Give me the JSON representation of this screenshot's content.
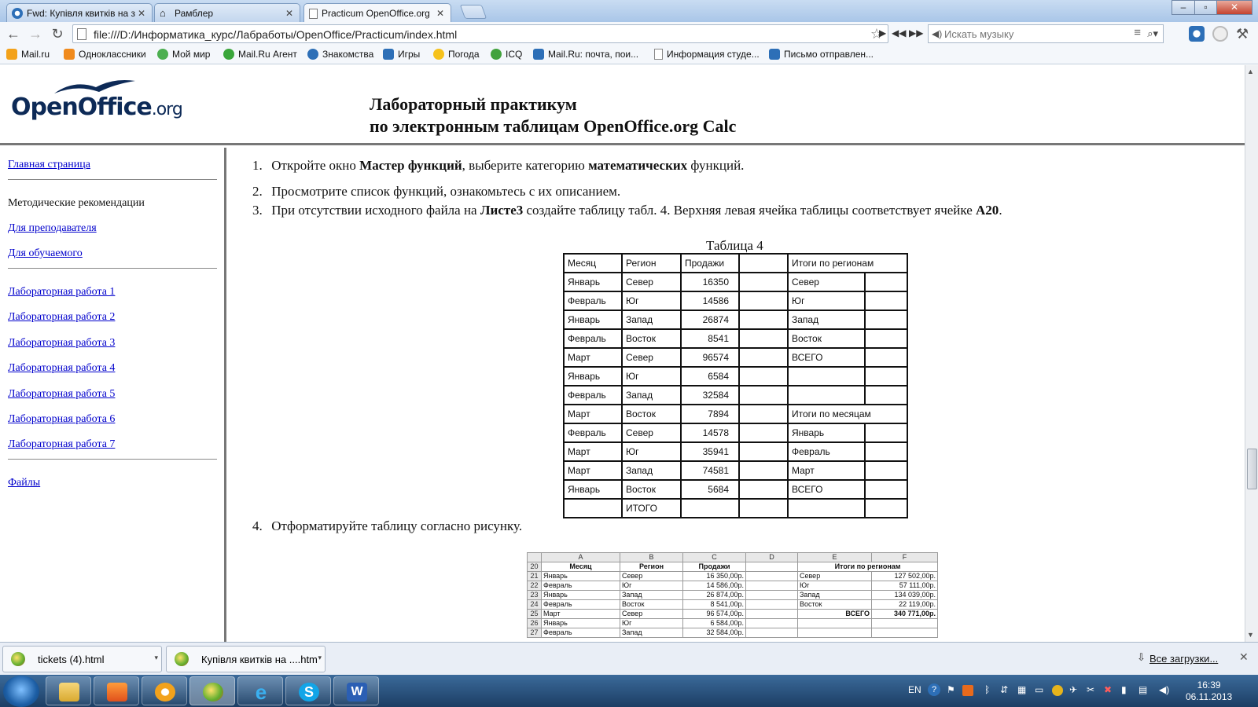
{
  "browser": {
    "tabs": [
      {
        "label": "Fwd: Купівля квитків на з",
        "active": false
      },
      {
        "label": "Рамблер",
        "active": false
      },
      {
        "label": "Practicum OpenOffice.org",
        "active": true
      }
    ],
    "url": "file:///D:/Информатика_курс/Лабработы/OpenOffice/Practicum/index.html",
    "music_search_placeholder": "Искать музыку",
    "bookmarks": [
      "Mail.ru",
      "Одноклассники",
      "Мой мир",
      "Mail.Ru Агент",
      "Знакомства",
      "Игры",
      "Погода",
      "ICQ",
      "Mail.Ru: почта, пои...",
      "Информация студе...",
      "Письмо отправлен..."
    ]
  },
  "page": {
    "logo_main": "OpenOffice",
    "logo_suffix": ".org",
    "title_line1": "Лабораторный практикум",
    "title_line2": "по электронным таблицам OpenOffice.org Calc",
    "sidebar": {
      "home": "Главная страница",
      "methodical": "Методические рекомендации",
      "for_teacher": "Для преподавателя",
      "for_student": "Для обучаемого",
      "labs": [
        "Лабораторная работа 1",
        "Лабораторная работа 2",
        "Лабораторная работа 3",
        "Лабораторная работа 4",
        "Лабораторная работа 5",
        "Лабораторная работа 6",
        "Лабораторная работа 7"
      ],
      "files": "Файлы"
    },
    "steps": {
      "s1_num": "1.",
      "s1_a": "Откройте окно ",
      "s1_b": "Мастер функций",
      "s1_c": ", выберите категорию ",
      "s1_d": "математических",
      "s1_e": " функций.",
      "s2_num": "2.",
      "s2": "Просмотрите список функций, ознакомьтесь с их описанием.",
      "s3_num": "3.",
      "s3_a": "При отсутствии исходного файла на ",
      "s3_b": "Листе3",
      "s3_c": " создайте таблицу табл. 4. Верхняя левая ячейка таблицы соответствует ячейке ",
      "s3_d": "А20",
      "s3_e": ".",
      "s4_num": "4.",
      "s4": "Отформатируйте таблицу согласно рисунку."
    },
    "table_caption": "Таблица 4",
    "table": {
      "headers": [
        "Месяц",
        "Регион",
        "Продажи",
        "",
        "Итоги по регионам"
      ],
      "rows": [
        [
          "Январь",
          "Север",
          "16350",
          "",
          "Север",
          ""
        ],
        [
          "Февраль",
          "Юг",
          "14586",
          "",
          "Юг",
          ""
        ],
        [
          "Январь",
          "Запад",
          "26874",
          "",
          "Запад",
          ""
        ],
        [
          "Февраль",
          "Восток",
          "8541",
          "",
          "Восток",
          ""
        ],
        [
          "Март",
          "Север",
          "96574",
          "",
          "ВСЕГО",
          ""
        ],
        [
          "Январь",
          "Юг",
          "6584",
          "",
          "",
          ""
        ],
        [
          "Февраль",
          "Запад",
          "32584",
          "",
          "",
          ""
        ],
        [
          "Март",
          "Восток",
          "7894",
          "",
          "Итоги по месяцам",
          null
        ],
        [
          "Февраль",
          "Север",
          "14578",
          "",
          "Январь",
          ""
        ],
        [
          "Март",
          "Юг",
          "35941",
          "",
          "Февраль",
          ""
        ],
        [
          "Март",
          "Запад",
          "74581",
          "",
          "Март",
          ""
        ],
        [
          "Январь",
          "Восток",
          "5684",
          "",
          "ВСЕГО",
          ""
        ],
        [
          "",
          "ИТОГО",
          "",
          "",
          "",
          ""
        ]
      ]
    },
    "sheet_image": {
      "col_headers": [
        "",
        "A",
        "B",
        "C",
        "D",
        "E",
        "F"
      ],
      "rows": [
        [
          "20",
          "Месяц",
          "Регион",
          "Продажи",
          "",
          "Итоги по регионам",
          ""
        ],
        [
          "21",
          "Январь",
          "Север",
          "16 350,00р.",
          "",
          "Север",
          "127 502,00р."
        ],
        [
          "22",
          "Февраль",
          "Юг",
          "14 586,00р.",
          "",
          "Юг",
          "57 111,00р."
        ],
        [
          "23",
          "Январь",
          "Запад",
          "26 874,00р.",
          "",
          "Запад",
          "134 039,00р."
        ],
        [
          "24",
          "Февраль",
          "Восток",
          "8 541,00р.",
          "",
          "Восток",
          "22 119,00р."
        ],
        [
          "25",
          "Март",
          "Север",
          "96 574,00р.",
          "",
          "ВСЕГО",
          "340 771,00р."
        ],
        [
          "26",
          "Январь",
          "Юг",
          "6 584,00р.",
          "",
          "",
          ""
        ],
        [
          "27",
          "Февраль",
          "Запад",
          "32 584,00р.",
          "",
          "",
          ""
        ]
      ]
    }
  },
  "downloads": {
    "items": [
      "tickets (4).html",
      "Купівля квитків на ....htm"
    ],
    "all_label": "Все загрузки..."
  },
  "taskbar": {
    "lang": "EN",
    "time": "16:39",
    "date": "06.11.2013"
  },
  "colors": {
    "link": "#0000cc",
    "logo": "#0d2a57",
    "taskbar": "#1c3e64"
  }
}
